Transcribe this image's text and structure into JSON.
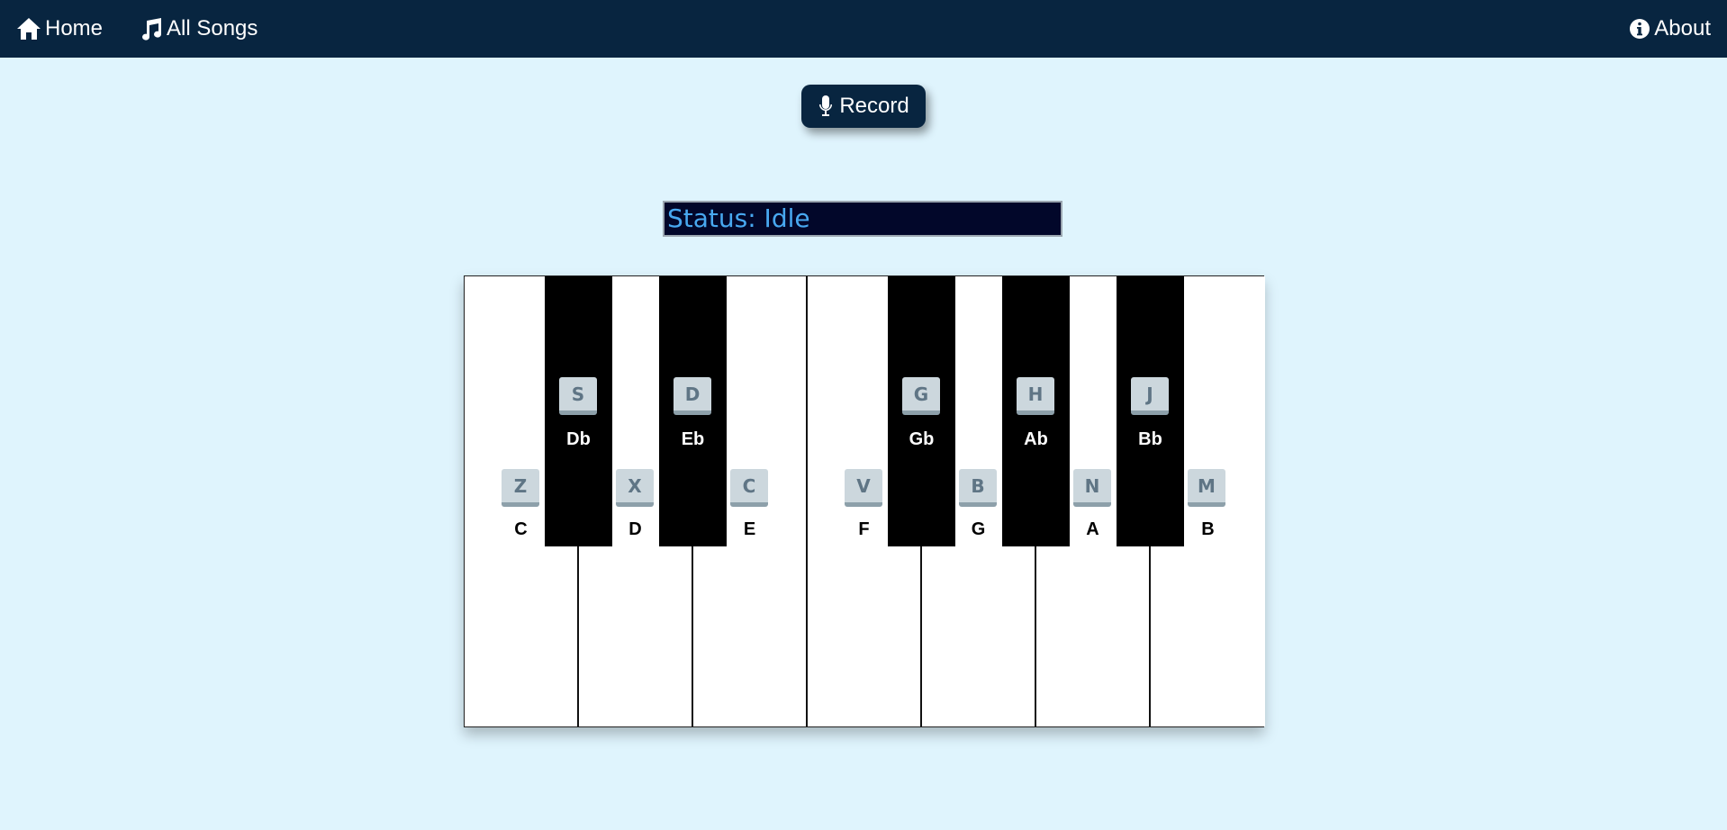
{
  "nav": {
    "home": {
      "label": "Home",
      "icon": "home-icon"
    },
    "songs": {
      "label": "All Songs",
      "icon": "music-note-icon"
    },
    "about": {
      "label": "About",
      "icon": "info-icon"
    }
  },
  "record": {
    "label": "Record",
    "icon": "microphone-icon"
  },
  "status": {
    "text": "Status: Idle"
  },
  "piano": {
    "white_keys": [
      {
        "note": "C",
        "key": "Z"
      },
      {
        "note": "D",
        "key": "X"
      },
      {
        "note": "E",
        "key": "C"
      },
      {
        "note": "F",
        "key": "V"
      },
      {
        "note": "G",
        "key": "B"
      },
      {
        "note": "A",
        "key": "N"
      },
      {
        "note": "B",
        "key": "M"
      }
    ],
    "black_keys": [
      {
        "note": "Db",
        "key": "S"
      },
      {
        "note": "Eb",
        "key": "D"
      },
      {
        "note": "Gb",
        "key": "G"
      },
      {
        "note": "Ab",
        "key": "H"
      },
      {
        "note": "Bb",
        "key": "J"
      }
    ]
  },
  "colors": {
    "navbar": "#082540",
    "background": "#dff4fd",
    "status_bg": "#02072a",
    "status_text": "#48a8f0"
  }
}
